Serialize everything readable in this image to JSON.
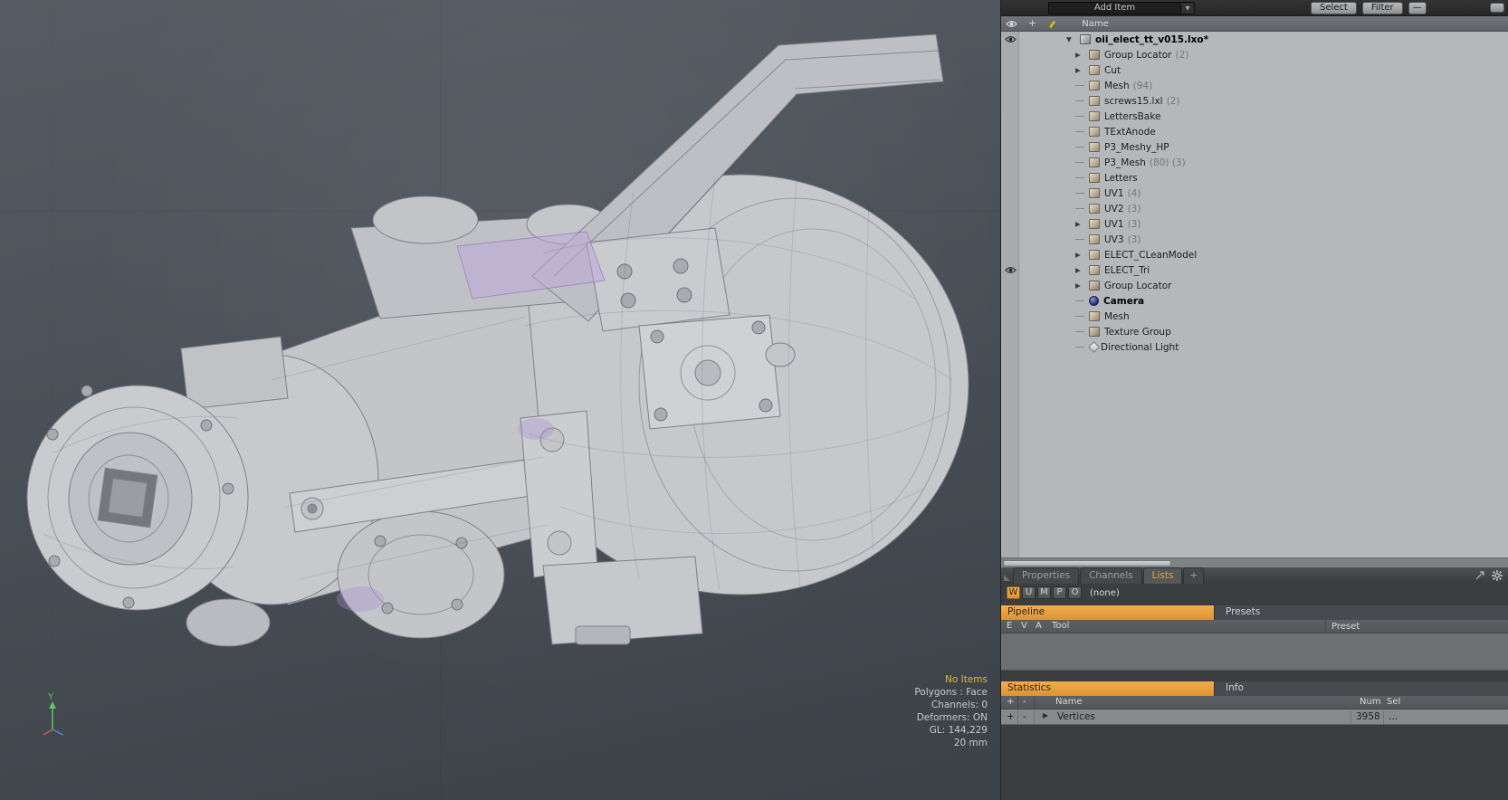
{
  "colors": {
    "accent_orange": "#e9a13e",
    "status_yellow": "#e0bc2e",
    "panel_dark": "#3b3e41",
    "list_bg": "#b4b8bb",
    "viewport_top": "#565c63",
    "viewport_bottom": "#3c4148"
  },
  "viewport": {
    "axis_y_label": "Y",
    "status": {
      "no_items": "No Items",
      "polygons": "Polygons : Face",
      "channels": "Channels: 0",
      "deformers": "Deformers: ON",
      "gl": "GL: 144,229",
      "grid_size": "20 mm"
    }
  },
  "item_list": {
    "toolbar": {
      "add_item_label": "Add Item",
      "select_label": "Select",
      "filter_label": "Filter",
      "options_glyph": "—"
    },
    "header": {
      "name_label": "Name"
    },
    "items": [
      {
        "label": "oii_elect_tt_v015.lxo*",
        "indent": 0,
        "icon": "scene",
        "expander": "open",
        "eye": true,
        "bold": true
      },
      {
        "label": "Group Locator",
        "suffix": "(2)",
        "indent": 1,
        "icon": "group",
        "expander": "closed"
      },
      {
        "label": "Cut",
        "indent": 1,
        "icon": "mesh",
        "expander": "closed"
      },
      {
        "label": "Mesh",
        "suffix": "(94)",
        "indent": 1,
        "icon": "mesh"
      },
      {
        "label": "screws15.lxl",
        "suffix": "(2)",
        "indent": 1,
        "icon": "mesh"
      },
      {
        "label": "LettersBake",
        "indent": 1,
        "icon": "mesh"
      },
      {
        "label": "TExtAnode",
        "indent": 1,
        "icon": "mesh"
      },
      {
        "label": "P3_Meshy_HP",
        "indent": 1,
        "icon": "mesh"
      },
      {
        "label": "P3_Mesh",
        "suffix": "(80) (3)",
        "indent": 1,
        "icon": "mesh"
      },
      {
        "label": "Letters",
        "indent": 1,
        "icon": "mesh"
      },
      {
        "label": "UV1",
        "suffix": "(4)",
        "indent": 1,
        "icon": "mesh"
      },
      {
        "label": "UV2",
        "suffix": "(3)",
        "indent": 1,
        "icon": "mesh"
      },
      {
        "label": "UV1",
        "suffix": "(3)",
        "indent": 1,
        "icon": "mesh",
        "expander": "closed"
      },
      {
        "label": "UV3",
        "suffix": "(3)",
        "indent": 1,
        "icon": "mesh"
      },
      {
        "label": "ELECT_CLeanModel",
        "indent": 1,
        "icon": "mesh",
        "expander": "closed"
      },
      {
        "label": "ELECT_Tri",
        "indent": 1,
        "icon": "mesh",
        "expander": "closed",
        "eye": true
      },
      {
        "label": "Group Locator",
        "indent": 1,
        "icon": "group",
        "expander": "closed"
      },
      {
        "label": "Camera",
        "indent": 1,
        "icon": "camera",
        "bold": true
      },
      {
        "label": "Mesh",
        "indent": 1,
        "icon": "mesh"
      },
      {
        "label": "Texture Group",
        "indent": 1,
        "icon": "group"
      },
      {
        "label": "Directional Light",
        "indent": 1,
        "icon": "light"
      }
    ]
  },
  "bottom": {
    "tabs": [
      "Properties",
      "Channels",
      "Lists"
    ],
    "active_tab": "Lists",
    "tab_add": "+",
    "mode_buttons": [
      "W",
      "U",
      "M",
      "P",
      "O"
    ],
    "active_mode": "W",
    "mode_value": "(none)",
    "pipeline": {
      "title": "Pipeline",
      "presets_label": "Presets",
      "col_e": "E",
      "col_v": "V",
      "col_a": "A",
      "col_tool": "Tool",
      "col_preset": "Preset"
    },
    "statistics": {
      "title": "Statistics",
      "info_label": "Info",
      "col_plus": "+",
      "col_minus": "-",
      "col_name": "Name",
      "col_num": "Num",
      "col_sel": "Sel",
      "rows": [
        {
          "plus": "+",
          "minus": "-",
          "name": "Vertices",
          "num": "3958",
          "sel": "..."
        }
      ]
    }
  },
  "icons": {
    "expander_open": "▼",
    "expander_closed": "▶",
    "dropdown_arrow": "▼",
    "eye": "css-shape",
    "pen": "css-shape",
    "gear": "css-shape",
    "plus": "+"
  }
}
